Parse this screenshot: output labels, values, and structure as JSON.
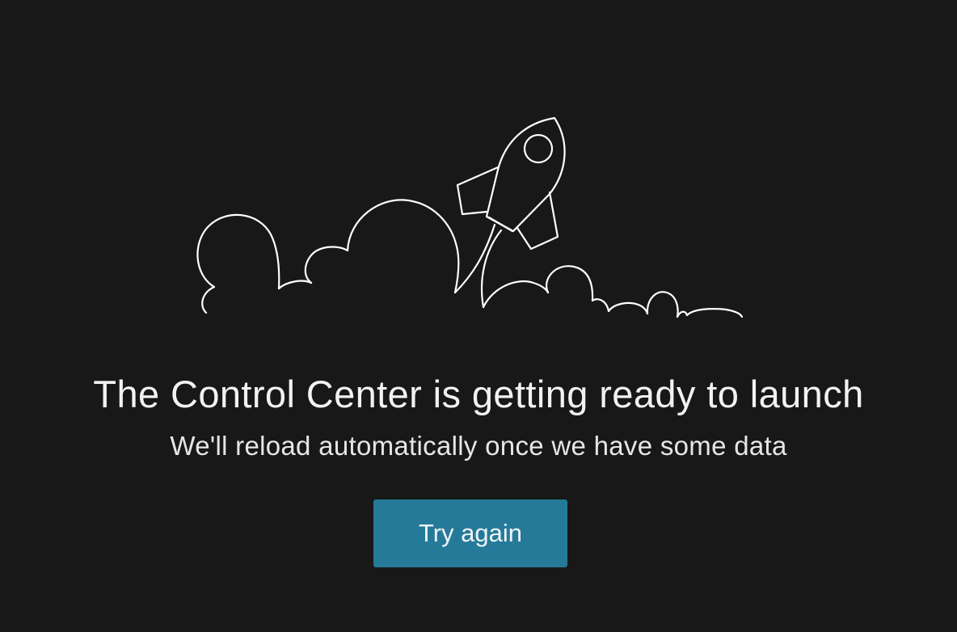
{
  "illustration": {
    "icon": "rocket-launch-icon",
    "stroke_color": "#ffffff"
  },
  "message": {
    "title": "The Control Center is getting ready to launch",
    "subtitle": "We'll reload automatically once we have some data"
  },
  "actions": {
    "retry_label": "Try again"
  },
  "colors": {
    "background": "#181818",
    "button": "#267a99",
    "text": "#f2f2f2"
  }
}
